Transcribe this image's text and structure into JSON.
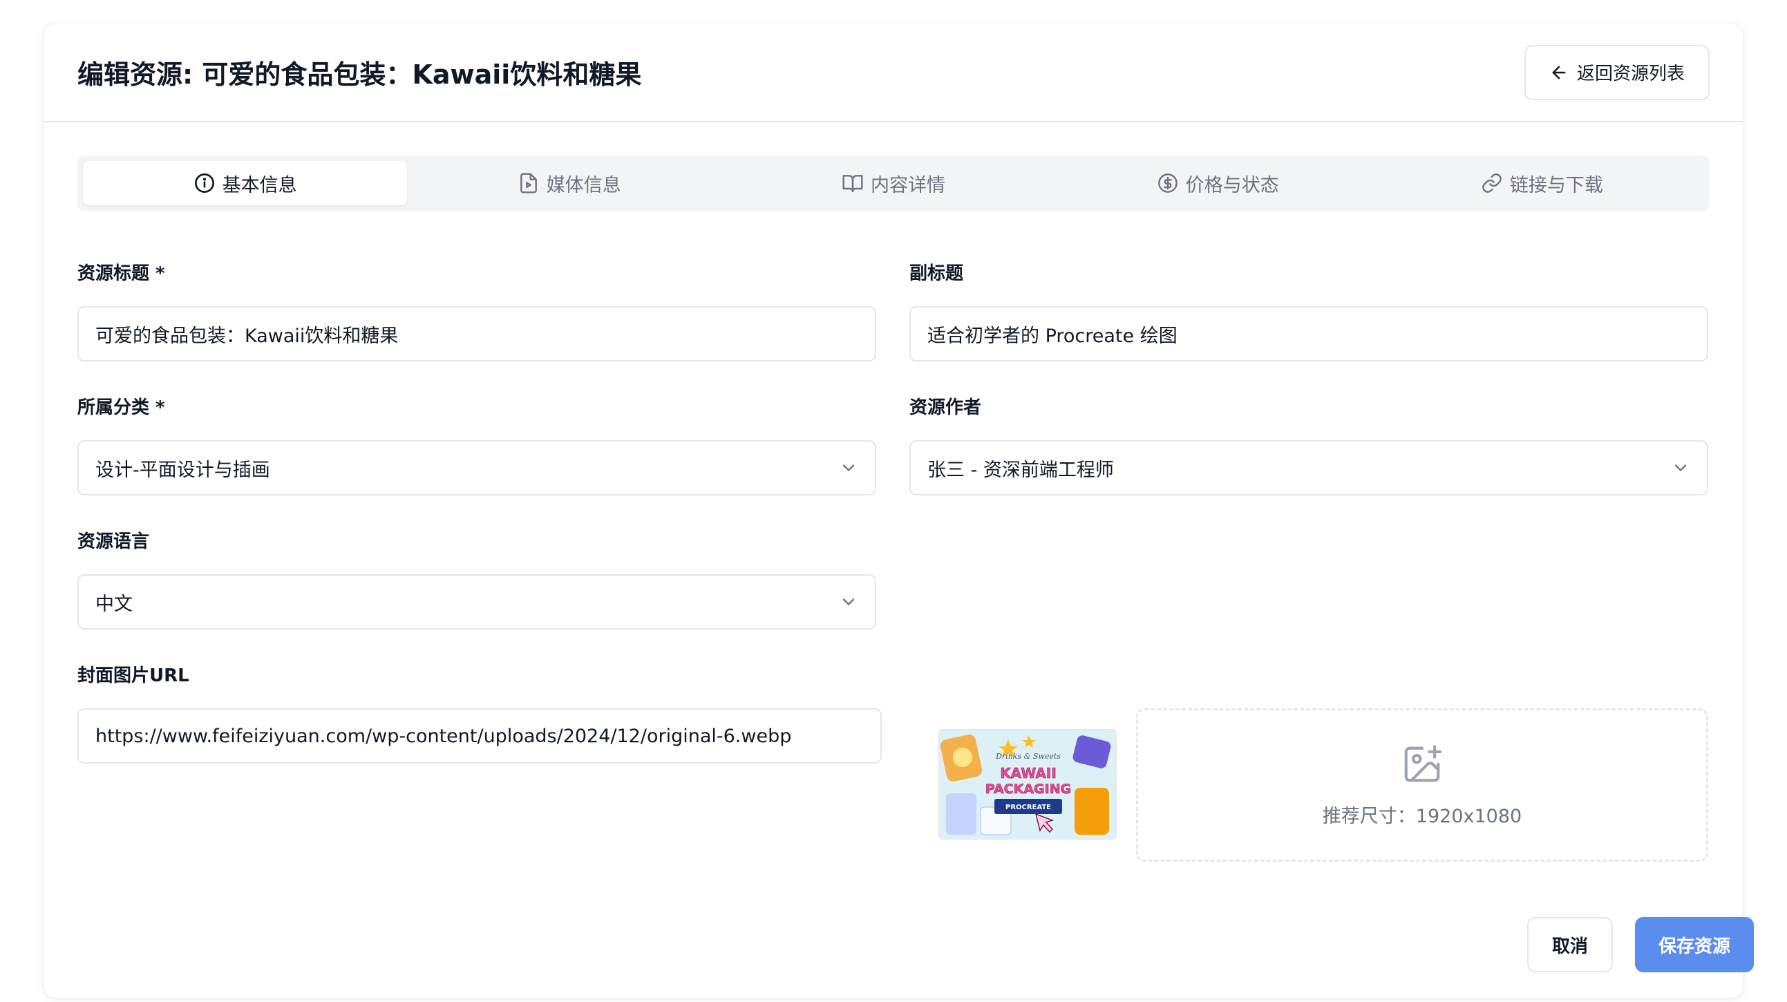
{
  "header": {
    "title": "编辑资源: 可爱的食品包装：Kawaii饮料和糖果",
    "back_label": "返回资源列表"
  },
  "tabs": [
    {
      "label": "基本信息",
      "icon": "info-icon",
      "active": true
    },
    {
      "label": "媒体信息",
      "icon": "file-video-icon",
      "active": false
    },
    {
      "label": "内容详情",
      "icon": "book-open-icon",
      "active": false
    },
    {
      "label": "价格与状态",
      "icon": "dollar-circle-icon",
      "active": false
    },
    {
      "label": "链接与下载",
      "icon": "link-icon",
      "active": false
    }
  ],
  "form": {
    "title": {
      "label": "资源标题 *",
      "value": "可爱的食品包装：Kawaii饮料和糖果"
    },
    "subtitle": {
      "label": "副标题",
      "value": "适合初学者的 Procreate 绘图"
    },
    "category": {
      "label": "所属分类 *",
      "value": "设计-平面设计与插画"
    },
    "author": {
      "label": "资源作者",
      "value": "张三 - 资深前端工程师"
    },
    "language": {
      "label": "资源语言",
      "value": "中文"
    },
    "cover": {
      "label": "封面图片URL",
      "value": "https://www.feifeiziyuan.com/wp-content/uploads/2024/12/original-6.webp",
      "thumb_text": {
        "top": "Drinks & Sweets",
        "main1": "KAWAII",
        "main2": "PACKAGING",
        "tag": "PROCREATE"
      },
      "upload_hint": "推荐尺寸：1920x1080"
    }
  },
  "actions": {
    "cancel": "取消",
    "save": "保存资源"
  },
  "colors": {
    "primary": "#5b8def",
    "border": "#e2e8f0",
    "tab_bg": "#f3f4f6"
  }
}
